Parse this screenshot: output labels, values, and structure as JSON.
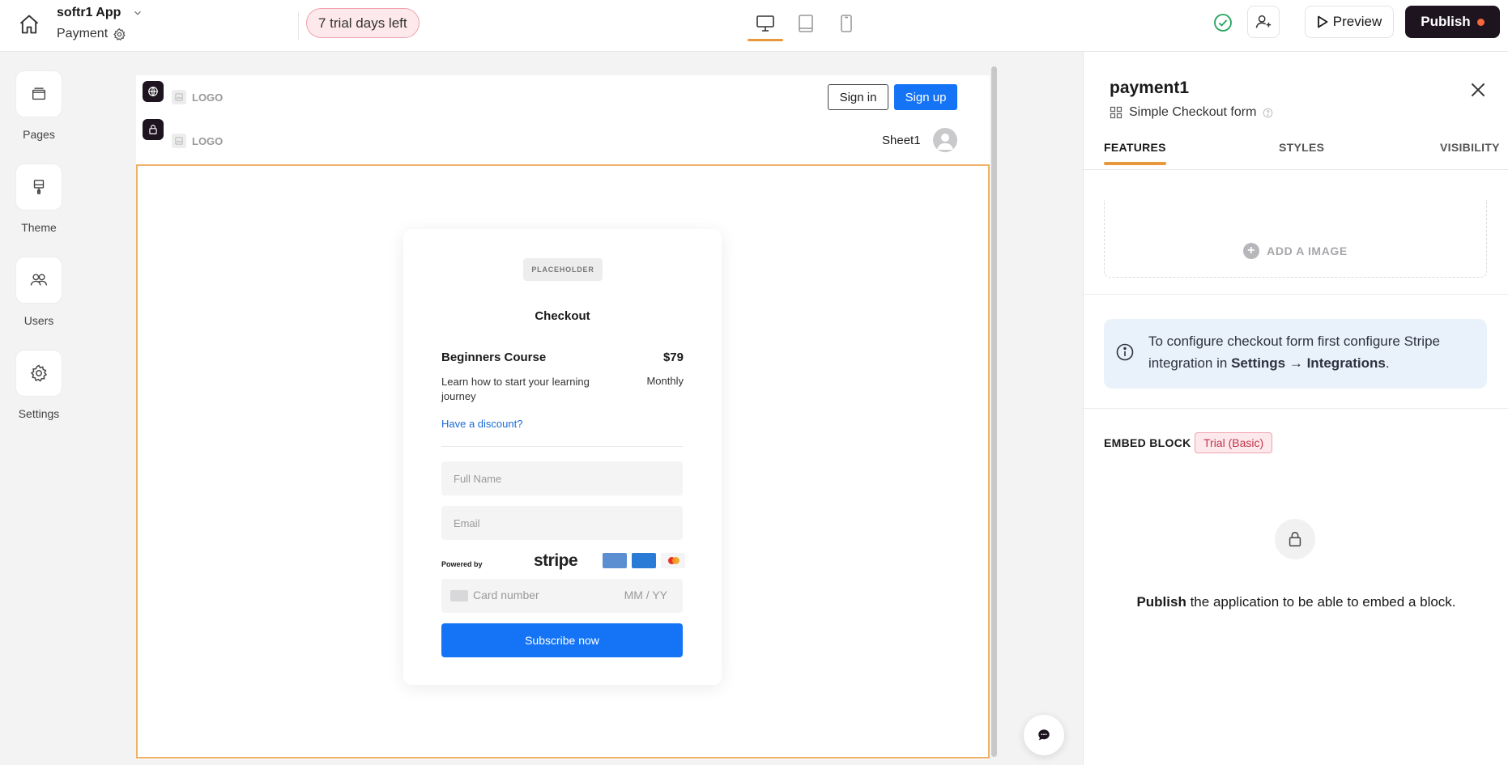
{
  "header": {
    "app_name": "softr1 App",
    "page_name": "Payment",
    "trial_text": "7 trial days left",
    "preview_label": "Preview",
    "publish_label": "Publish"
  },
  "sidebar": {
    "items": [
      {
        "label": "Pages",
        "icon": "pages-icon"
      },
      {
        "label": "Theme",
        "icon": "theme-icon"
      },
      {
        "label": "Users",
        "icon": "users-icon"
      },
      {
        "label": "Settings",
        "icon": "settings-icon"
      }
    ]
  },
  "canvas": {
    "public_nav": {
      "logo": "LOGO",
      "signin": "Sign in",
      "signup": "Sign up"
    },
    "private_nav": {
      "logo": "LOGO",
      "user_label": "Sheet1"
    },
    "checkout": {
      "placeholder": "PLACEHOLDER",
      "title": "Checkout",
      "product_name": "Beginners Course",
      "price": "$79",
      "description": "Learn how to start your learning journey",
      "period": "Monthly",
      "discount_link": "Have a discount?",
      "full_name_placeholder": "Full Name",
      "email_placeholder": "Email",
      "powered_by": "Powered by",
      "stripe": "stripe",
      "card_number_placeholder": "Card number",
      "expiry_placeholder": "MM / YY",
      "subscribe_label": "Subscribe now"
    }
  },
  "panel": {
    "title": "payment1",
    "subtitle": "Simple Checkout form",
    "tabs": [
      {
        "label": "FEATURES",
        "active": true
      },
      {
        "label": "STYLES",
        "active": false
      },
      {
        "label": "VISIBILITY",
        "active": false
      }
    ],
    "add_image_label": "ADD A IMAGE",
    "info": {
      "text_before": "To configure checkout form first configure Stripe integration in ",
      "text_bold": "Settings → Integrations",
      "text_after": "."
    },
    "embed_label": "EMBED BLOCK",
    "embed_badge": "Trial (Basic)",
    "publish_note_bold": "Publish",
    "publish_note_rest": " the application to be able to embed a block."
  },
  "colors": {
    "accent_orange": "#e9973b",
    "primary_blue": "#1574f5",
    "publish_dark": "#1d1420",
    "trial_pink": "#fde8eb"
  }
}
